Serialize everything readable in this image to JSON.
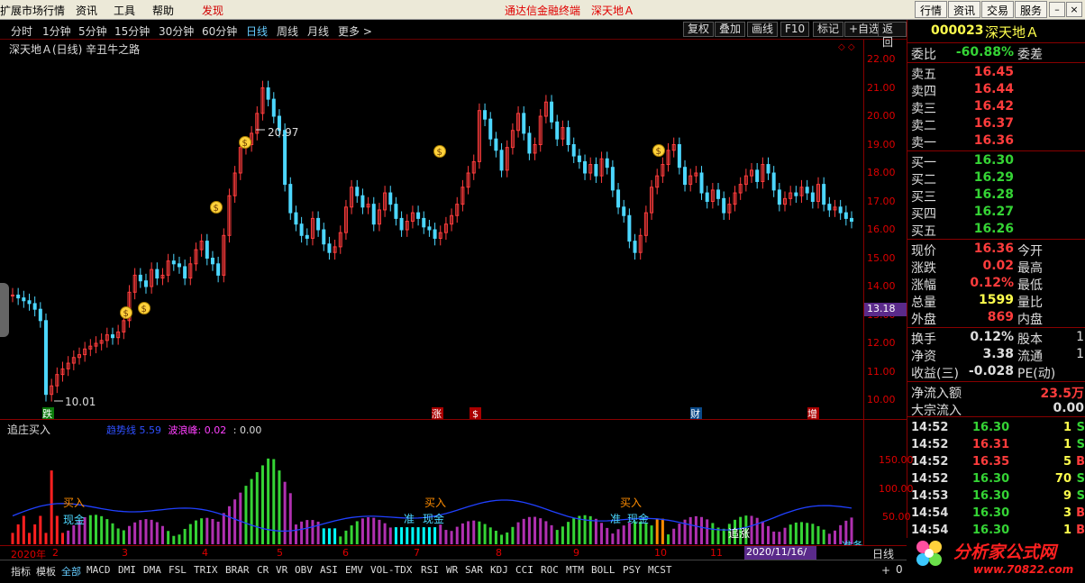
{
  "menubar": {
    "items": [
      "扩展市场行情",
      "资讯",
      "工具",
      "帮助",
      "发现"
    ],
    "center_title": "通达信金融终端",
    "center_stock": "深天地Ａ",
    "right_buttons": [
      "行情",
      "资讯",
      "交易",
      "服务"
    ],
    "window_buttons": [
      "–",
      "□",
      "×"
    ]
  },
  "periods": [
    "分时",
    "1分钟",
    "5分钟",
    "15分钟",
    "30分钟",
    "60分钟",
    "日线",
    "周线",
    "月线",
    "更多 >"
  ],
  "active_period": "日线",
  "toolbar": [
    "复权",
    "叠加",
    "画线",
    "F10",
    "标记",
    "+自选",
    "返回"
  ],
  "kline": {
    "title": "深天地Ａ(日线) 辛丑牛之路",
    "high_label": "20.97",
    "low_label": "10.01",
    "current_price_tag": "13.18",
    "price_labels": [
      "22.00",
      "21.00",
      "20.00",
      "19.00",
      "18.00",
      "17.00",
      "16.00",
      "15.00",
      "14.00",
      "13.00",
      "12.00",
      "11.00",
      "10.00"
    ],
    "event_markers": [
      "跌",
      "涨",
      "$",
      "财",
      "增"
    ]
  },
  "indicator": {
    "name": "追庄买入",
    "line1_label": "趋势线",
    "line1_value": "5.59",
    "line2_label": "波浪峰",
    "line2_value": "0.02",
    "line3_value": "0.00",
    "axis_labels": [
      "150.00",
      "100.00",
      "50.00"
    ],
    "annotations": [
      "买入",
      "现金",
      "买入",
      "准",
      "现金",
      "买入",
      "准",
      "现金",
      "追涨",
      "准备"
    ]
  },
  "date_axis": {
    "labels": [
      "2020年",
      "2",
      "3",
      "4",
      "5",
      "6",
      "7",
      "8",
      "9",
      "10",
      "11"
    ],
    "cursor_date": "2020/11/16/—",
    "period_label": "日线"
  },
  "tabs": [
    "指标",
    "模板",
    "全部",
    "MACD",
    "DMI",
    "DMA",
    "FSL",
    "TRIX",
    "BRAR",
    "CR",
    "VR",
    "OBV",
    "ASI",
    "EMV",
    "VOL-TDX",
    "RSI",
    "WR",
    "SAR",
    "KDJ",
    "CCI",
    "ROC",
    "MTM",
    "BOLL",
    "PSY",
    "MCST"
  ],
  "active_tab": "全部",
  "quote": {
    "code": "000023",
    "name": "深天地Ａ",
    "weibi_label": "委比",
    "weibi_value": "-60.88%",
    "weicha_label": "委差",
    "sells": [
      {
        "label": "卖五",
        "price": "16.45"
      },
      {
        "label": "卖四",
        "price": "16.44"
      },
      {
        "label": "卖三",
        "price": "16.42"
      },
      {
        "label": "卖二",
        "price": "16.37"
      },
      {
        "label": "卖一",
        "price": "16.36"
      }
    ],
    "buys": [
      {
        "label": "买一",
        "price": "16.30"
      },
      {
        "label": "买二",
        "price": "16.29"
      },
      {
        "label": "买三",
        "price": "16.28"
      },
      {
        "label": "买四",
        "price": "16.27"
      },
      {
        "label": "买五",
        "price": "16.26"
      }
    ],
    "stats": [
      {
        "label": "现价",
        "value": "16.36",
        "label2": "今开"
      },
      {
        "label": "涨跌",
        "value": "0.02",
        "label2": "最高"
      },
      {
        "label": "涨幅",
        "value": "0.12%",
        "label2": "最低"
      },
      {
        "label": "总量",
        "value": "1599",
        "label2": "量比"
      },
      {
        "label": "外盘",
        "value": "869",
        "label2": "内盘"
      }
    ],
    "stats2": [
      {
        "label": "换手",
        "value": "0.12%",
        "label2": "股本",
        "value2": "1"
      },
      {
        "label": "净资",
        "value": "3.38",
        "label2": "流通",
        "value2": "1"
      },
      {
        "label": "收益(三)",
        "value": "-0.028",
        "label2": "PE(动)",
        "value2": ""
      }
    ],
    "flows": [
      {
        "label": "净流入额",
        "value": "23.5万"
      },
      {
        "label": "大宗流入",
        "value": "0.00"
      }
    ]
  },
  "ticks": [
    {
      "time": "14:52",
      "price": "16.30",
      "vol": "1",
      "flag": "S"
    },
    {
      "time": "14:52",
      "price": "16.31",
      "vol": "1",
      "flag": "S"
    },
    {
      "time": "14:52",
      "price": "16.35",
      "vol": "5",
      "flag": "B"
    },
    {
      "time": "14:52",
      "price": "16.30",
      "vol": "70",
      "flag": "S"
    },
    {
      "time": "14:53",
      "price": "16.30",
      "vol": "9",
      "flag": "S"
    },
    {
      "time": "14:54",
      "price": "16.30",
      "vol": "3",
      "flag": "B"
    },
    {
      "time": "14:54",
      "price": "16.30",
      "vol": "1",
      "flag": "B"
    }
  ],
  "watermark": {
    "text": "分析家公式网",
    "url": "www.70822.com"
  },
  "colors": {
    "up": "#ff3c3c",
    "down": "#4cd7ff",
    "green": "#35d435",
    "border": "#880000"
  }
}
